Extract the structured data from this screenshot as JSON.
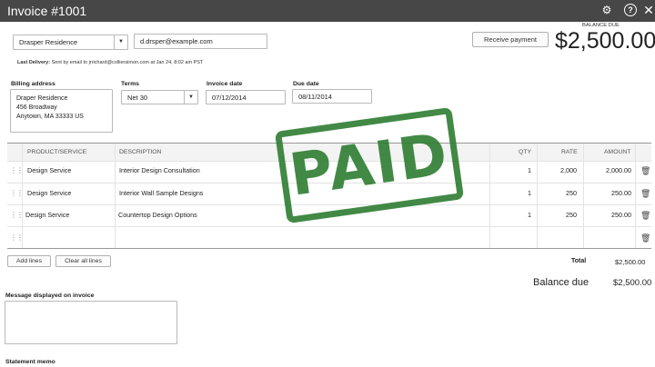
{
  "window": {
    "title": "Invoice #1001"
  },
  "header_icons": [
    "gear-icon",
    "help-icon",
    "close-icon"
  ],
  "customer": {
    "value": "Drasper Residence"
  },
  "email": {
    "value": "d.drsper@example.com"
  },
  "last_delivery": {
    "label": "Last Delivery:",
    "text": "Sent by email to jrrichard@colliersimon.com at Jan 24, 8:02 am PST"
  },
  "receive_payment": {
    "label": "Receive payment"
  },
  "balance": {
    "label": "BALANCE DUE",
    "amount": "$2,500.00"
  },
  "billing": {
    "label": "Billing address",
    "line1": "Draper Residence",
    "line2": "456 Broadway",
    "line3": "Anytown, MA  33333 US"
  },
  "terms": {
    "label": "Terms",
    "value": "Net 30"
  },
  "invoice_date": {
    "label": "Invoice date",
    "value": "07/12/2014"
  },
  "due_date": {
    "label": "Due date",
    "value": "08/11/2014"
  },
  "table": {
    "headers": {
      "product": "PRODUCT/SERVICE",
      "description": "DESCRIPTION",
      "qty": "QTY",
      "rate": "RATE",
      "amount": "AMOUNT"
    },
    "rows": [
      {
        "product": "Design Service",
        "description": "Interior Design Consultation",
        "qty": "1",
        "rate": "2,000",
        "amount": "2,000.00"
      },
      {
        "product": "Design Service",
        "description": "Interior Wall Sample Designs",
        "qty": "1",
        "rate": "250",
        "amount": "250.00"
      },
      {
        "product": "Design Service",
        "description": "Countertop Design Options",
        "qty": "1",
        "rate": "250",
        "amount": "250.00"
      }
    ]
  },
  "stamp": {
    "text": "PAID"
  },
  "buttons": {
    "add_lines": "Add lines",
    "clear_all": "Clear all lines"
  },
  "totals": {
    "total_label": "Total",
    "total_value": "$2,500.00",
    "balance_label": "Balance due",
    "balance_value": "$2,500.00"
  },
  "message": {
    "label": "Message displayed on invoice"
  },
  "memo": {
    "label": "Statement memo"
  },
  "colors": {
    "header_bg": "#474747",
    "stamp_green": "#2e7d32"
  }
}
